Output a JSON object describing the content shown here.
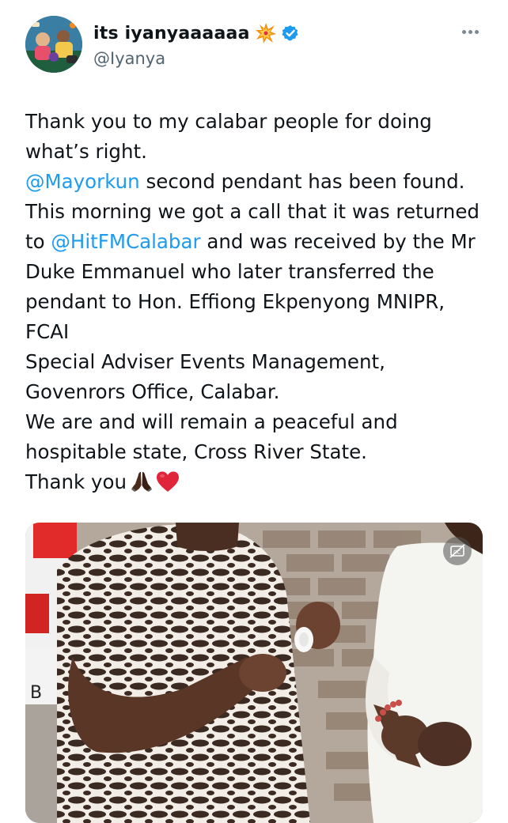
{
  "author": {
    "display_name": "its iyanyaaaaaa",
    "handle": "@Iyanya",
    "name_emoji_icon": "collision-burst-icon",
    "verified_icon": "verified-badge-icon",
    "verified_color": "#1d9bf0"
  },
  "header": {
    "more_icon": "more-options-icon"
  },
  "tweet": {
    "lines": [
      [
        "Thank you to my calabar people for doing"
      ],
      [
        "what’s right."
      ],
      [
        "@Mayorkun",
        " second pendant has been found."
      ],
      [
        "This morning we got a call that it was returned"
      ],
      [
        "to ",
        "@HitFMCalabar",
        " and was received by the Mr"
      ],
      [
        "Duke Emmanuel who later transferred the"
      ],
      [
        "pendant to Hon. Effiong Ekpenyong MNIPR,"
      ],
      [
        "FCAI"
      ],
      [
        "Special Adviser Events Management,"
      ],
      [
        "Govenrors Office, Calabar."
      ],
      [
        "We are and will remain a peaceful and"
      ],
      [
        "hospitable state, Cross River State."
      ],
      [
        "Thank you"
      ]
    ],
    "mentions": [
      "@Mayorkun",
      "@HitFMCalabar"
    ],
    "trailing_emoji_icons": [
      "folded-hands-icon",
      "red-heart-icon"
    ],
    "mention_color": "#1d9bf0"
  },
  "media": {
    "type": "video",
    "captions_icon": "closed-captions-icon",
    "background_sign_text": "B"
  }
}
